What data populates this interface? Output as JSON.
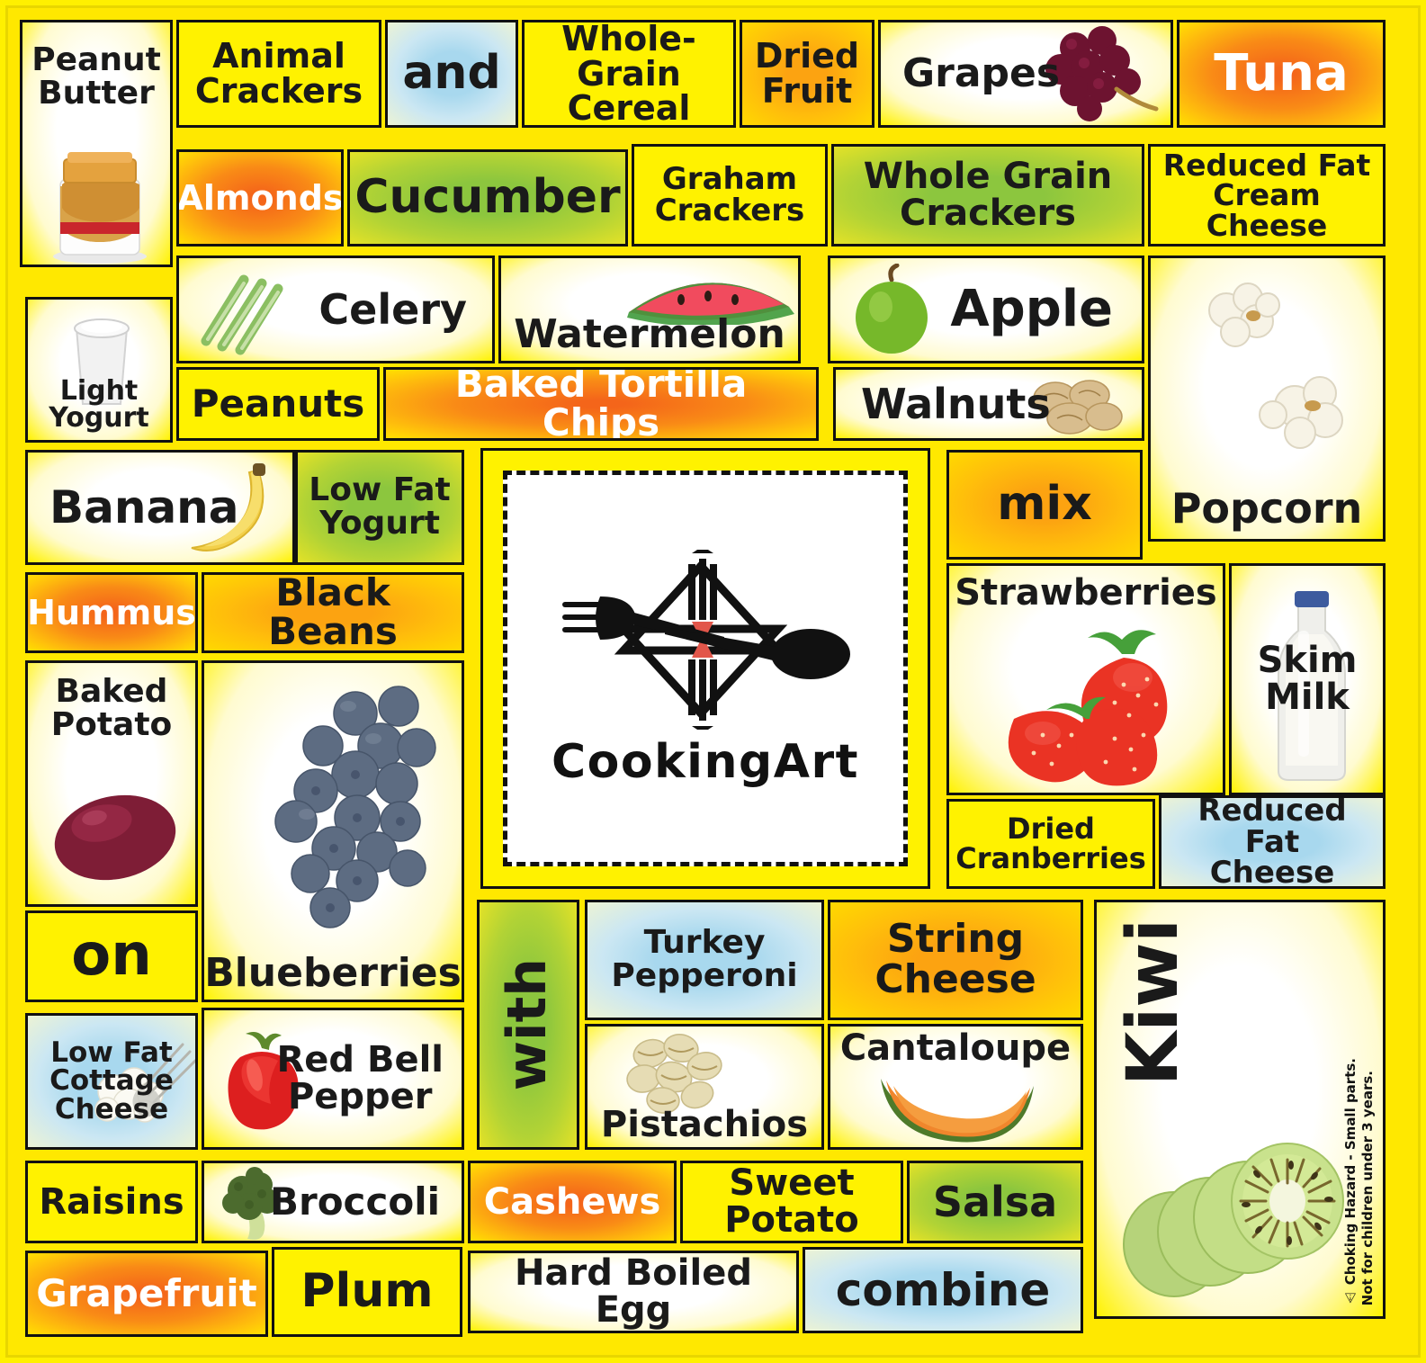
{
  "poster": {
    "brand": "CookingArt",
    "background_color": "#ffe800",
    "border_color": "#111111",
    "warning": "⚠ Choking Hazard - Small parts.\nNot for children under 3 years."
  },
  "palette": {
    "yellow": "#fff200",
    "orange": "#f4651a",
    "amber": "#fca311",
    "green": "#8cc63e",
    "blue": "#a8d8ee",
    "white": "#ffffff",
    "text_dark": "#1a1a1a",
    "text_light": "#ffffff"
  },
  "tiles": [
    {
      "id": "peanut-butter",
      "label": "Peanut\nButter",
      "bg": "white",
      "text": "dark",
      "image": "peanut-butter-jar"
    },
    {
      "id": "animal-crackers",
      "label": "Animal\nCrackers",
      "bg": "yellow",
      "text": "dark",
      "image": null
    },
    {
      "id": "and",
      "label": "and",
      "bg": "blue",
      "text": "dark",
      "image": null
    },
    {
      "id": "whole-grain-cereal",
      "label": "Whole-Grain\nCereal",
      "bg": "yellow",
      "text": "dark",
      "image": null
    },
    {
      "id": "dried-fruit",
      "label": "Dried\nFruit",
      "bg": "amber",
      "text": "dark",
      "image": null
    },
    {
      "id": "grapes",
      "label": "Grapes",
      "bg": "white",
      "text": "dark",
      "image": "grapes"
    },
    {
      "id": "tuna",
      "label": "Tuna",
      "bg": "orange",
      "text": "light",
      "image": null
    },
    {
      "id": "almonds",
      "label": "Almonds",
      "bg": "orange",
      "text": "light",
      "image": null
    },
    {
      "id": "cucumber",
      "label": "Cucumber",
      "bg": "green",
      "text": "dark",
      "image": null
    },
    {
      "id": "graham-crackers",
      "label": "Graham\nCrackers",
      "bg": "yellow",
      "text": "dark",
      "image": null
    },
    {
      "id": "whole-grain-crackers",
      "label": "Whole Grain\nCrackers",
      "bg": "green",
      "text": "dark",
      "image": null
    },
    {
      "id": "reduced-fat-cream-cheese",
      "label": "Reduced Fat\nCream Cheese",
      "bg": "yellow",
      "text": "dark",
      "image": null
    },
    {
      "id": "light-yogurt",
      "label": "Light\nYogurt",
      "bg": "white",
      "text": "dark",
      "image": "yogurt-cup"
    },
    {
      "id": "celery",
      "label": "Celery",
      "bg": "white",
      "text": "dark",
      "image": "celery-sticks"
    },
    {
      "id": "watermelon",
      "label": "Watermelon",
      "bg": "white",
      "text": "dark",
      "image": "watermelon-slice"
    },
    {
      "id": "apple",
      "label": "Apple",
      "bg": "white",
      "text": "dark",
      "image": "green-apple"
    },
    {
      "id": "peanuts",
      "label": "Peanuts",
      "bg": "yellow",
      "text": "dark",
      "image": null
    },
    {
      "id": "baked-tortilla-chips",
      "label": "Baked Tortilla Chips",
      "bg": "orange",
      "text": "light",
      "image": null
    },
    {
      "id": "walnuts",
      "label": "Walnuts",
      "bg": "white",
      "text": "dark",
      "image": "walnut-halves"
    },
    {
      "id": "popcorn",
      "label": "Popcorn",
      "bg": "white",
      "text": "dark",
      "image": "popcorn"
    },
    {
      "id": "banana",
      "label": "Banana",
      "bg": "white",
      "text": "dark",
      "image": "banana"
    },
    {
      "id": "low-fat-yogurt",
      "label": "Low Fat\nYogurt",
      "bg": "green",
      "text": "dark",
      "image": null
    },
    {
      "id": "mix",
      "label": "mix",
      "bg": "amber",
      "text": "dark",
      "image": null
    },
    {
      "id": "hummus",
      "label": "Hummus",
      "bg": "orange",
      "text": "light",
      "image": null
    },
    {
      "id": "black-beans",
      "label": "Black Beans",
      "bg": "amber",
      "text": "dark",
      "image": null
    },
    {
      "id": "baked-potato",
      "label": "Baked\nPotato",
      "bg": "white",
      "text": "dark",
      "image": "red-potato"
    },
    {
      "id": "blueberries",
      "label": "Blueberries",
      "bg": "white",
      "text": "dark",
      "image": "blueberries"
    },
    {
      "id": "strawberries",
      "label": "Strawberries",
      "bg": "white",
      "text": "dark",
      "image": "strawberries"
    },
    {
      "id": "skim-milk",
      "label": "Skim\nMilk",
      "bg": "white",
      "text": "dark",
      "image": "milk-bottle"
    },
    {
      "id": "dried-cranberries",
      "label": "Dried\nCranberries",
      "bg": "yellow",
      "text": "dark",
      "image": null
    },
    {
      "id": "reduced-fat-cheese",
      "label": "Reduced Fat\nCheese",
      "bg": "blue",
      "text": "dark",
      "image": null
    },
    {
      "id": "on",
      "label": "on",
      "bg": "yellow",
      "text": "dark",
      "image": null
    },
    {
      "id": "with",
      "label": "with",
      "bg": "green",
      "text": "dark",
      "image": null
    },
    {
      "id": "turkey-pepperoni",
      "label": "Turkey\nPepperoni",
      "bg": "blue",
      "text": "dark",
      "image": null
    },
    {
      "id": "string-cheese",
      "label": "String\nCheese",
      "bg": "amber",
      "text": "dark",
      "image": null
    },
    {
      "id": "pistachios",
      "label": "Pistachios",
      "bg": "white",
      "text": "dark",
      "image": "pistachios"
    },
    {
      "id": "cantaloupe",
      "label": "Cantaloupe",
      "bg": "white",
      "text": "dark",
      "image": "cantaloupe-slice"
    },
    {
      "id": "kiwi",
      "label": "Kiwi",
      "bg": "white",
      "text": "dark",
      "image": "kiwi-slices"
    },
    {
      "id": "low-fat-cottage-cheese",
      "label": "Low Fat\nCottage\nCheese",
      "bg": "blue",
      "text": "dark",
      "image": "cottage-cheese-fork"
    },
    {
      "id": "red-bell-pepper",
      "label": "Red Bell\nPepper",
      "bg": "white",
      "text": "dark",
      "image": "red-bell-pepper"
    },
    {
      "id": "raisins",
      "label": "Raisins",
      "bg": "yellow",
      "text": "dark",
      "image": null
    },
    {
      "id": "broccoli",
      "label": "Broccoli",
      "bg": "white",
      "text": "dark",
      "image": "broccoli"
    },
    {
      "id": "cashews",
      "label": "Cashews",
      "bg": "orange",
      "text": "light",
      "image": null
    },
    {
      "id": "sweet-potato",
      "label": "Sweet Potato",
      "bg": "yellow",
      "text": "dark",
      "image": null
    },
    {
      "id": "salsa",
      "label": "Salsa",
      "bg": "green",
      "text": "dark",
      "image": null
    },
    {
      "id": "grapefruit",
      "label": "Grapefruit",
      "bg": "orange",
      "text": "light",
      "image": null
    },
    {
      "id": "plum",
      "label": "Plum",
      "bg": "yellow",
      "text": "dark",
      "image": null
    },
    {
      "id": "hard-boiled-egg",
      "label": "Hard Boiled Egg",
      "bg": "white",
      "text": "dark",
      "image": null
    },
    {
      "id": "combine",
      "label": "combine",
      "bg": "blue",
      "text": "dark",
      "image": null
    }
  ]
}
